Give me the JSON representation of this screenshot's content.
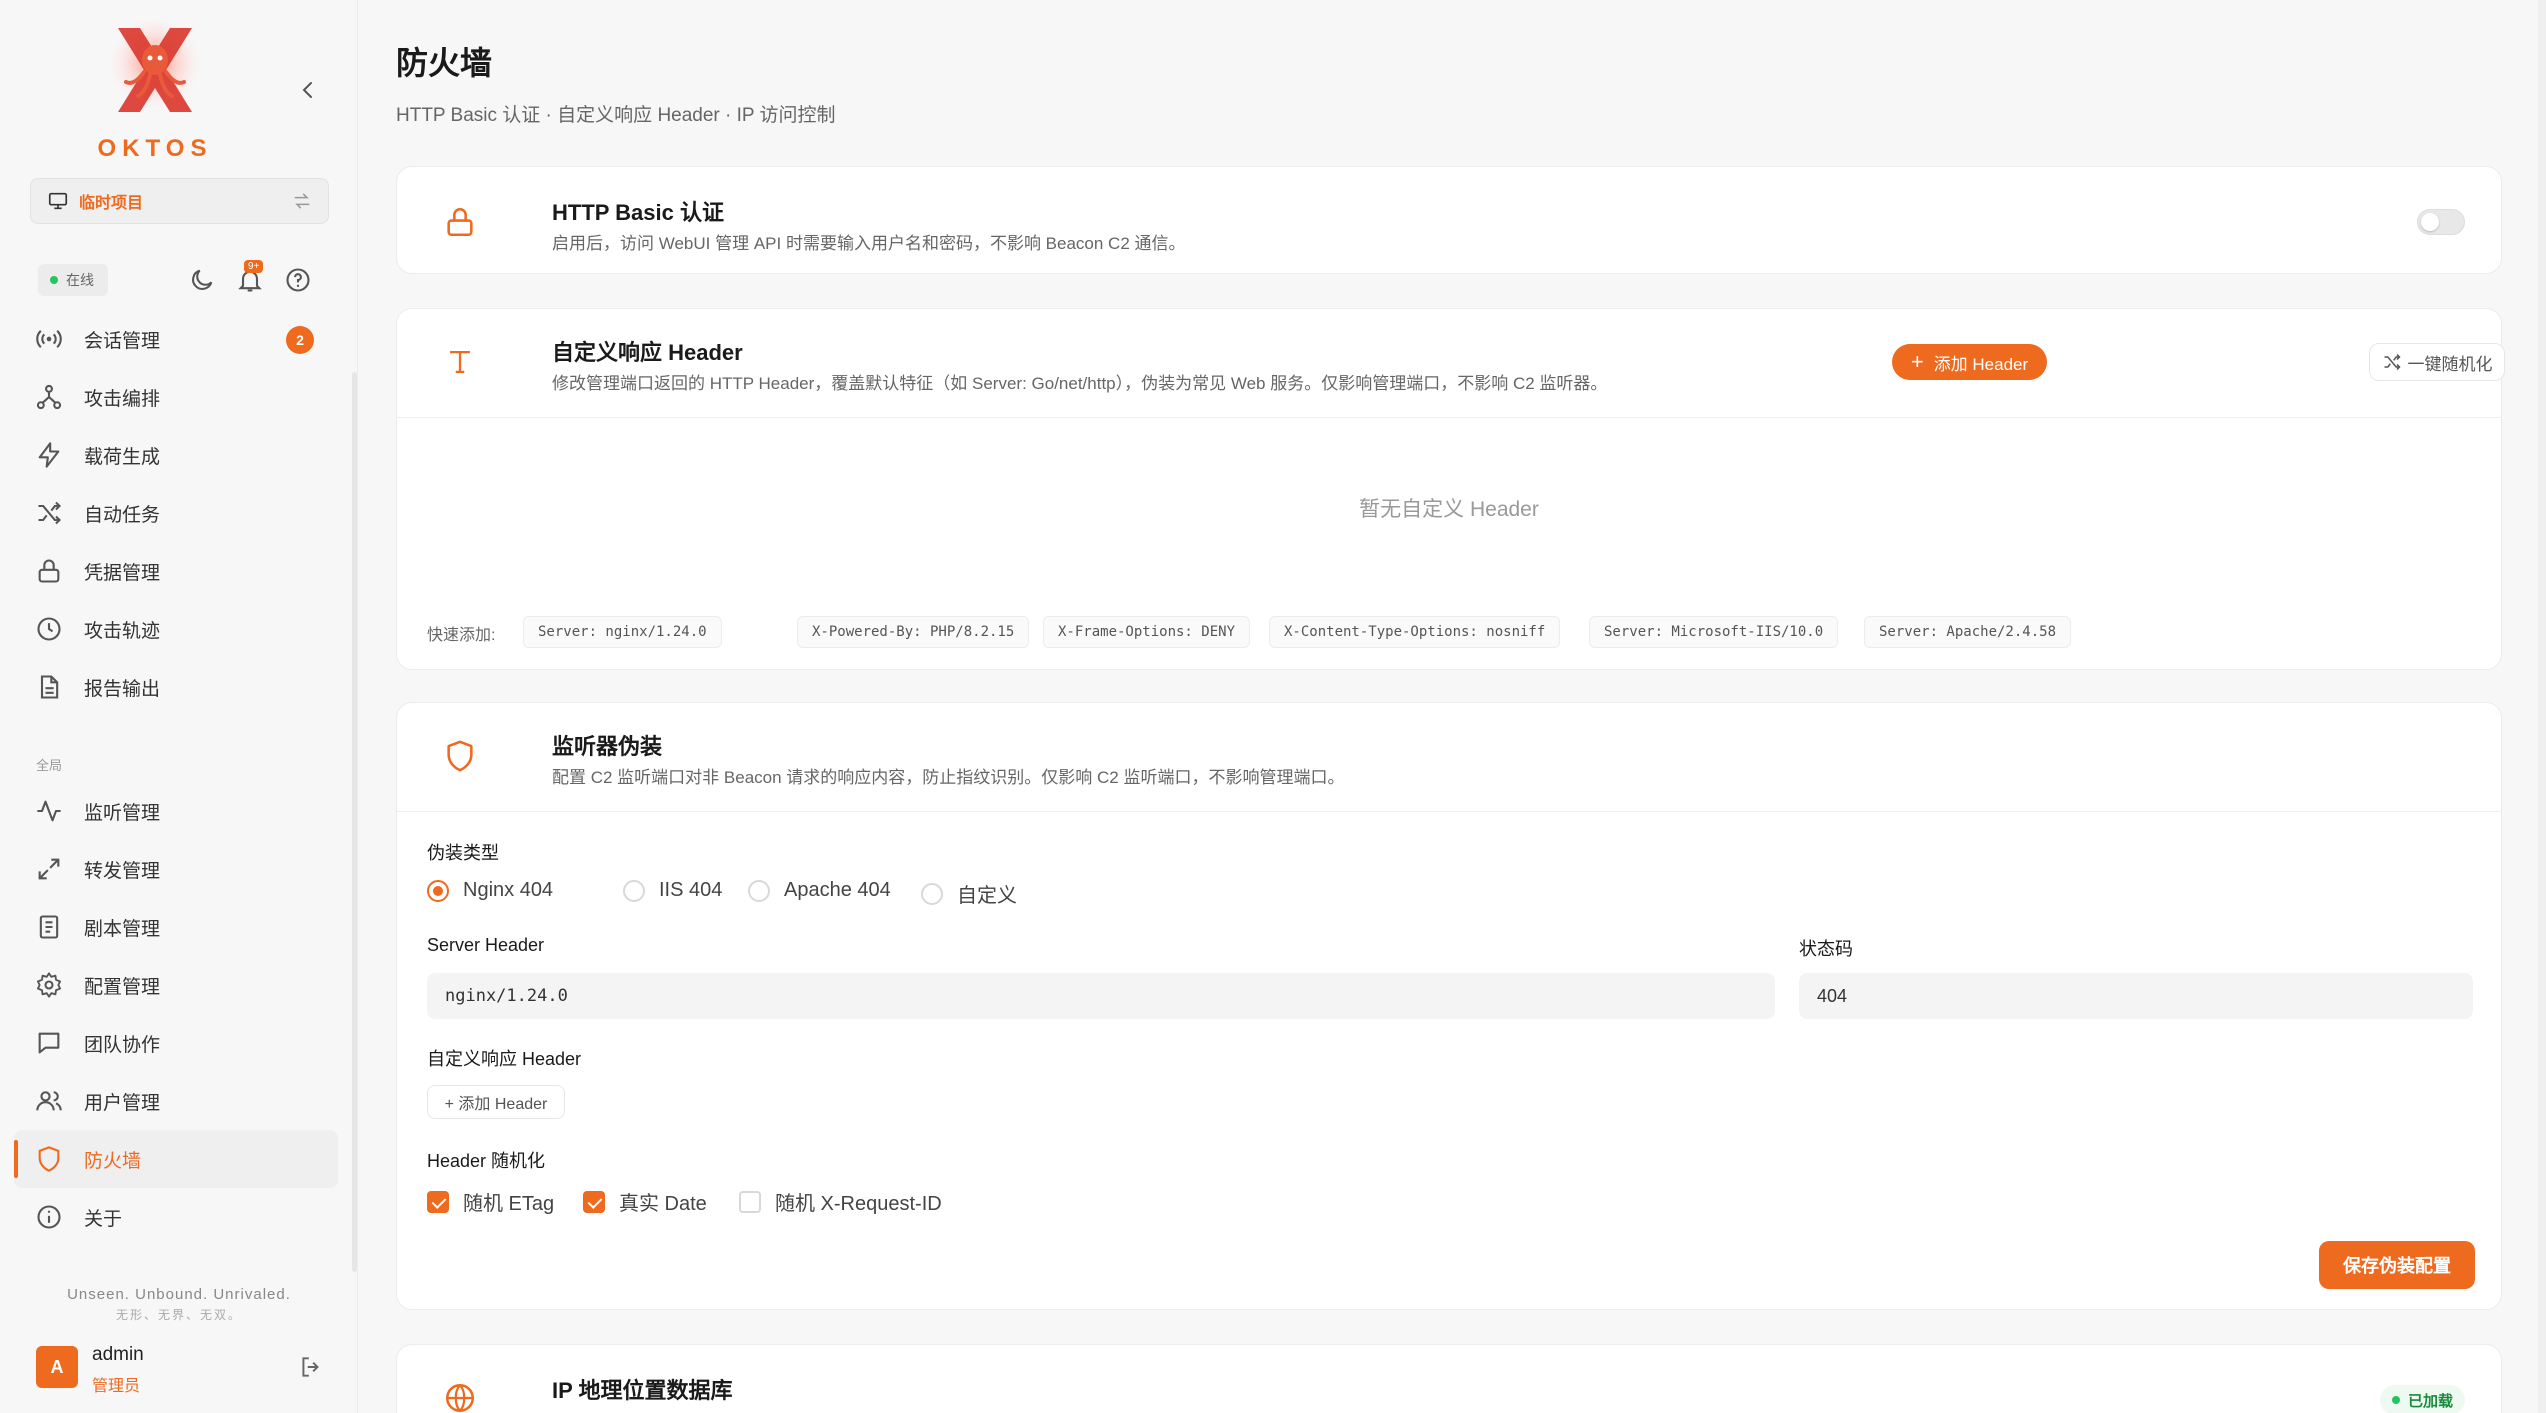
{
  "brand": {
    "name": "OKTOS",
    "accent": "#ee6a1f"
  },
  "project": {
    "label": "临时项目"
  },
  "status": {
    "online": "在线",
    "notif_badge": "9+"
  },
  "nav": {
    "items": [
      {
        "label": "会话管理",
        "icon": "radio-waves-icon",
        "count": "2"
      },
      {
        "label": "攻击编排",
        "icon": "graph-nodes-icon"
      },
      {
        "label": "载荷生成",
        "icon": "lightning-icon"
      },
      {
        "label": "自动任务",
        "icon": "shuffle-icon"
      },
      {
        "label": "凭据管理",
        "icon": "lock-icon"
      },
      {
        "label": "攻击轨迹",
        "icon": "clock-icon"
      },
      {
        "label": "报告输出",
        "icon": "document-icon"
      }
    ],
    "section_global": "全局",
    "global_items": [
      {
        "label": "监听管理",
        "icon": "pulse-icon"
      },
      {
        "label": "转发管理",
        "icon": "expand-arrows-icon"
      },
      {
        "label": "剧本管理",
        "icon": "book-icon"
      },
      {
        "label": "配置管理",
        "icon": "gear-icon"
      },
      {
        "label": "团队协作",
        "icon": "chat-icon"
      },
      {
        "label": "用户管理",
        "icon": "users-icon"
      },
      {
        "label": "防火墙",
        "icon": "shield-icon",
        "active": true
      },
      {
        "label": "关于",
        "icon": "info-icon"
      }
    ]
  },
  "footer": {
    "tagline": "Unseen. Unbound. Unrivaled.",
    "tagline_cn": "无形、无界、无双。",
    "user": {
      "avatar": "A",
      "name": "admin",
      "role": "管理员"
    }
  },
  "page": {
    "title": "防火墙",
    "subtitle": "HTTP Basic 认证 · 自定义响应 Header · IP 访问控制"
  },
  "basic_auth": {
    "title": "HTTP Basic 认证",
    "desc": "启用后，访问 WebUI 管理 API 时需要输入用户名和密码，不影响 Beacon C2 通信。",
    "enabled": false
  },
  "custom_header": {
    "title": "自定义响应 Header",
    "desc": "修改管理端口返回的 HTTP Header，覆盖默认特征（如 Server: Go/net/http），伪装为常见 Web 服务。仅影响管理端口，不影响 C2 监听器。",
    "add_btn": "添加 Header",
    "random_btn": "一键随机化",
    "empty": "暂无自定义 Header",
    "quick_label": "快速添加:",
    "quick": [
      "Server: nginx/1.24.0",
      "X-Powered-By: PHP/8.2.15",
      "X-Frame-Options: DENY",
      "X-Content-Type-Options: nosniff",
      "Server: Microsoft-IIS/10.0",
      "Server: Apache/2.4.58"
    ]
  },
  "listener_disguise": {
    "title": "监听器伪装",
    "desc": "配置 C2 监听端口对非 Beacon 请求的响应内容，防止指纹识别。仅影响 C2 监听端口，不影响管理端口。",
    "type_label": "伪装类型",
    "types": [
      "Nginx 404",
      "IIS 404",
      "Apache 404",
      "自定义"
    ],
    "selected_type": "Nginx 404",
    "server_header_label": "Server Header",
    "server_header_value": "nginx/1.24.0",
    "status_code_label": "状态码",
    "status_code_value": "404",
    "custom_header_label": "自定义响应 Header",
    "add_header_btn": "+ 添加 Header",
    "random_label": "Header 随机化",
    "random_opts": [
      {
        "label": "随机 ETag",
        "checked": true
      },
      {
        "label": "真实 Date",
        "checked": true
      },
      {
        "label": "随机 X-Request-ID",
        "checked": false
      }
    ],
    "save_btn": "保存伪装配置"
  },
  "geoip": {
    "title": "IP 地理位置数据库",
    "status": "已加载"
  }
}
